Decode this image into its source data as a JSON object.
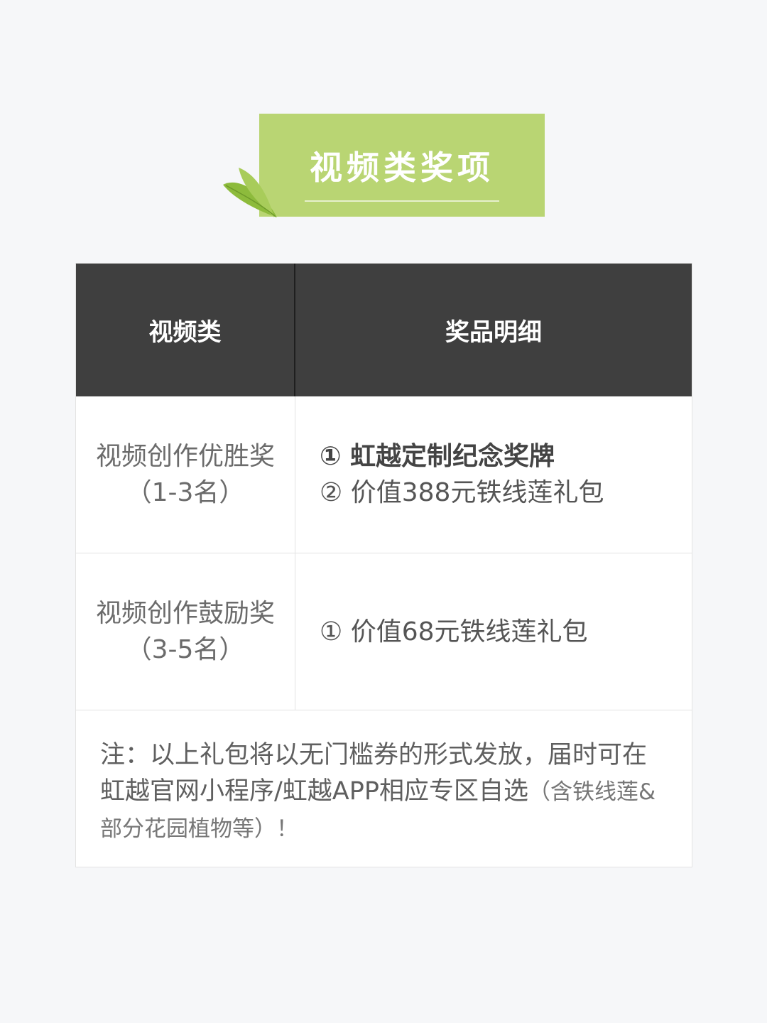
{
  "banner": {
    "title": "视频类奖项"
  },
  "table": {
    "headers": [
      "视频类",
      "奖品明细"
    ],
    "rows": [
      {
        "award_line1": "视频创作优胜奖",
        "award_line2": "（1-3名）",
        "prizes": [
          {
            "marker": "①",
            "text": "虹越定制纪念奖牌",
            "bold": true
          },
          {
            "marker": "②",
            "text": "价值388元铁线莲礼包",
            "bold": false
          }
        ]
      },
      {
        "award_line1": "视频创作鼓励奖",
        "award_line2": "（3-5名）",
        "prizes": [
          {
            "marker": "①",
            "text": "价值68元铁线莲礼包",
            "bold": false
          }
        ]
      }
    ],
    "note": {
      "main": "注：以上礼包将以无门槛券的形式发放，届时可在虹越官网小程序/虹越APP相应专区自选",
      "small": "（含铁线莲&部分花园植物等）！"
    }
  },
  "colors": {
    "banner": "#b9d573",
    "header_bg": "#3f3f3f",
    "leaf": "#8dbb3c"
  }
}
